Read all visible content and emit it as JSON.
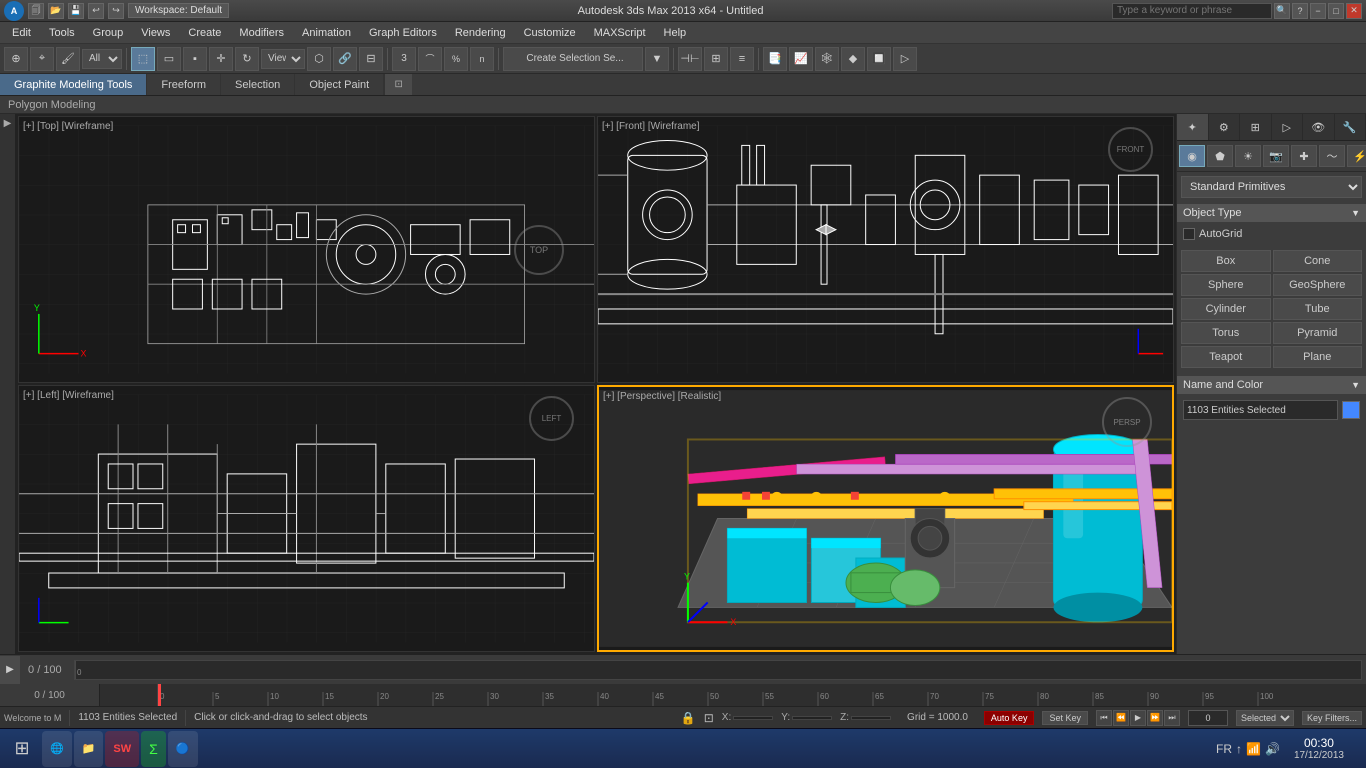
{
  "titlebar": {
    "title": "Autodesk 3ds Max 2013 x64 - Untitled",
    "workspace": "Workspace: Default",
    "search_placeholder": "Type a keyword or phrase",
    "buttons": {
      "minimize": "−",
      "maximize": "□",
      "close": "✕",
      "restore": "❐"
    }
  },
  "menubar": {
    "items": [
      "Edit",
      "Tools",
      "Group",
      "Views",
      "Create",
      "Modifiers",
      "Animation",
      "Graph Editors",
      "Rendering",
      "Customize",
      "MAXScript",
      "Help"
    ]
  },
  "ribbon": {
    "tabs": [
      {
        "label": "Graphite Modeling Tools",
        "active": true
      },
      {
        "label": "Freeform",
        "active": false
      },
      {
        "label": "Selection",
        "active": false
      },
      {
        "label": "Object Paint",
        "active": false
      }
    ],
    "polygon_modeling": "Polygon Modeling"
  },
  "viewports": [
    {
      "id": "top-left",
      "label": "[+] [Top] [Wireframe]",
      "nav_label": "TOP",
      "active": false
    },
    {
      "id": "top-right",
      "label": "[+] [Front] [Wireframe]",
      "nav_label": "FRONT",
      "active": false
    },
    {
      "id": "bottom-left",
      "label": "[+] [Left] [Wireframe]",
      "nav_label": "LEFT",
      "active": false
    },
    {
      "id": "bottom-right",
      "label": "[+] [Perspective] [Realistic]",
      "nav_label": "PERSP",
      "active": true
    }
  ],
  "right_panel": {
    "dropdown": "Standard Primitives",
    "object_type_header": "Object Type",
    "autogrid_label": "AutoGrid",
    "objects": {
      "row1": [
        "Box",
        "Cone"
      ],
      "row2": [
        "Sphere",
        "GeoSphere"
      ],
      "row3": [
        "Cylinder",
        "Tube"
      ],
      "row4": [
        "Torus",
        "Pyramid"
      ],
      "row5": [
        "Teapot",
        "Plane"
      ]
    },
    "name_color_header": "Name and Color",
    "name_value": "1103 Entities Selected",
    "color": "#4488ff"
  },
  "statusbar": {
    "selection": "1103 Entities Selected",
    "hint": "Click or click-and-drag to select objects",
    "x_label": "X:",
    "y_label": "Y:",
    "z_label": "Z:",
    "grid_label": "Grid = 1000.0",
    "autokey": "Auto Key",
    "set_key": "Set Key",
    "key_filters": "Key Filters..."
  },
  "timeline": {
    "frame": "0",
    "total": "100",
    "play": "▶"
  },
  "taskbar": {
    "start_label": "⊞",
    "apps": [
      {
        "name": "Chrome",
        "icon": "🌐"
      },
      {
        "name": "Files",
        "icon": "📁"
      },
      {
        "name": "SW",
        "icon": "SW"
      },
      {
        "name": "Sigma",
        "icon": "Σ"
      },
      {
        "name": "App5",
        "icon": "🔵"
      }
    ],
    "language": "FR",
    "time": "00:30",
    "date": "17/12/2013"
  },
  "toolbar": {
    "filter_label": "All",
    "view_label": "View"
  },
  "colors": {
    "active_viewport": "#ffaa00",
    "background_dark": "#1a1a1a",
    "background_mid": "#3c3c3c",
    "panel_bg": "#3a3a3a",
    "accent_blue": "#4488ff"
  }
}
